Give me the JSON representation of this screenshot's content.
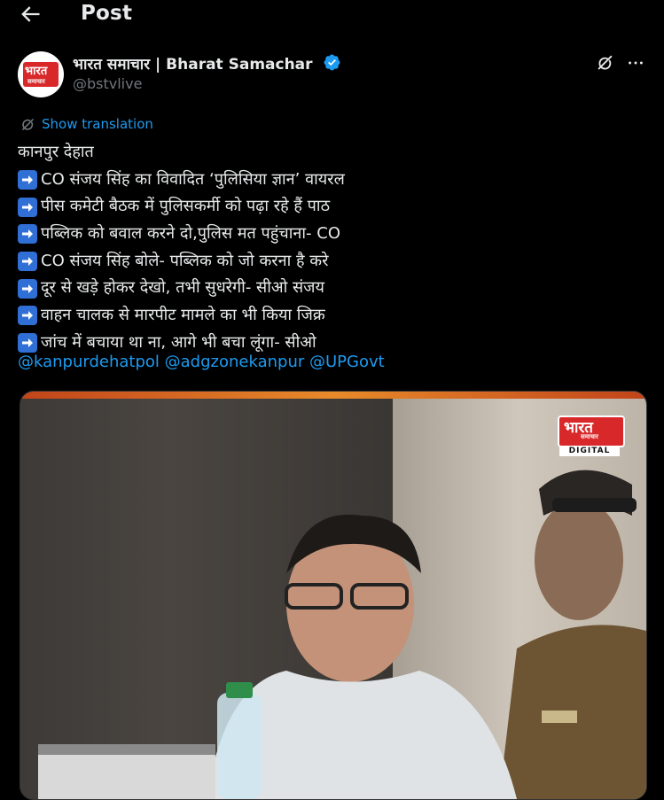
{
  "header": {
    "title": "Post"
  },
  "author": {
    "name": "भारत समाचार | Bharat Samachar",
    "handle": "@bstvlive",
    "avatar_logo": "भारत",
    "avatar_logo_sub": "समाचार"
  },
  "translation": {
    "label": "Show translation"
  },
  "tweet": {
    "lines": [
      {
        "arrow": false,
        "text": "कानपुर देहात"
      },
      {
        "arrow": true,
        "text": "CO संजय सिंह का विवादित ‘पुलिसिया ज्ञान’ वायरल"
      },
      {
        "arrow": true,
        "text": "पीस कमेटी बैठक में पुलिसकर्मी को पढ़ा रहे हैं पाठ"
      },
      {
        "arrow": true,
        "text": "पब्लिक को बवाल करने दो,पुलिस मत पहुंचाना- CO"
      },
      {
        "arrow": true,
        "text": "CO संजय सिंह बोले- पब्लिक को जो करना है करे"
      },
      {
        "arrow": true,
        "text": "दूर से खड़े होकर देखो, तभी सुधरेगी- सीओ संजय"
      },
      {
        "arrow": true,
        "text": "वाहन चालक से मारपीट मामले का भी किया जिक्र"
      },
      {
        "arrow": true,
        "text": "जांच में बचाया था ना, आगे भी बचा लूंगा- सीओ"
      }
    ],
    "mentions": [
      "@kanpurdehatpol",
      "@adgzonekanpur",
      "@UPGovt"
    ]
  },
  "media": {
    "watermark_main": "भारत",
    "watermark_sub": "समाचार",
    "watermark_label": "DIGITAL"
  },
  "icons": {
    "back": "back-arrow-icon",
    "verified": "verified-badge-icon",
    "grok": "grok-icon",
    "more": "more-options-icon",
    "translate": "translate-icon",
    "line_arrow": "right-arrow-emoji-icon"
  },
  "colors": {
    "background": "#000000",
    "text": "#e7e9ea",
    "muted": "#71767b",
    "link": "#1d9bf0",
    "brand_red": "#d8282a"
  }
}
